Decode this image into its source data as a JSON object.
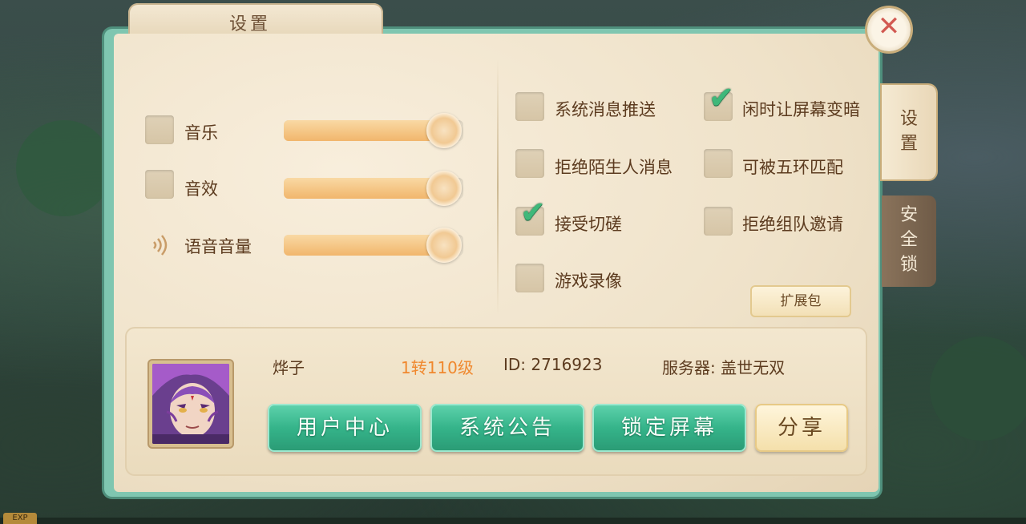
{
  "window": {
    "title": "设置"
  },
  "close": {
    "icon": "close-icon"
  },
  "audio": {
    "music": {
      "label": "音乐",
      "checked": false,
      "level": 1.0
    },
    "sfx": {
      "label": "音效",
      "checked": false,
      "level": 1.0
    },
    "voice": {
      "label": "语音音量",
      "icon": "speaker-icon",
      "level": 1.0
    }
  },
  "options": [
    {
      "label": "系统消息推送",
      "checked": false
    },
    {
      "label": "闲时让屏幕变暗",
      "checked": true
    },
    {
      "label": "拒绝陌生人消息",
      "checked": false
    },
    {
      "label": "可被五环匹配",
      "checked": false
    },
    {
      "label": "接受切磋",
      "checked": true
    },
    {
      "label": "拒绝组队邀请",
      "checked": false
    },
    {
      "label": "游戏录像",
      "checked": false
    }
  ],
  "expansion_button": "扩展包",
  "tabs": {
    "settings": "设置",
    "security_lock": "安全锁"
  },
  "account": {
    "name": "烨子",
    "level": "1转110级",
    "id": "ID: 2716923",
    "server": "服务器: 盖世无双",
    "buttons": {
      "user_center": "用户中心",
      "announcement": "系统公告",
      "lock_screen": "锁定屏幕",
      "share": "分享"
    }
  },
  "hud": {
    "exp_label": "EXP"
  },
  "colors": {
    "accent_green": "#35b48a",
    "level_orange": "#f0882e",
    "text_brown": "#5c3b1f"
  }
}
